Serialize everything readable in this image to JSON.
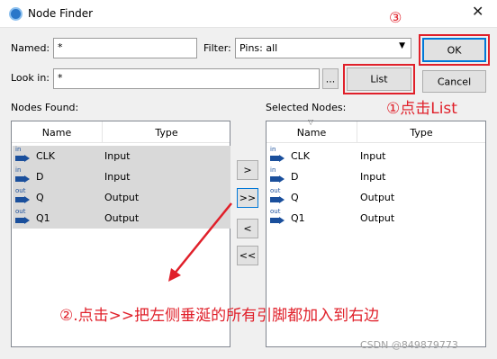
{
  "window": {
    "title": "Node Finder",
    "close_glyph": "✕"
  },
  "filter": {
    "named_label": "Named:",
    "named_value": "*",
    "filter_label": "Filter:",
    "filter_value": "Pins: all",
    "lookin_label": "Look in:",
    "lookin_value": "*",
    "browse_label": "...",
    "list_label": "List",
    "ok_label": "OK",
    "cancel_label": "Cancel"
  },
  "found": {
    "heading": "Nodes Found:",
    "col_name": "Name",
    "col_type": "Type",
    "rows": [
      {
        "dir": "in",
        "name": "CLK",
        "type": "Input"
      },
      {
        "dir": "in",
        "name": "D",
        "type": "Input"
      },
      {
        "dir": "out",
        "name": "Q",
        "type": "Output"
      },
      {
        "dir": "out",
        "name": "Q1",
        "type": "Output"
      }
    ]
  },
  "transfer": {
    "add_one": ">",
    "add_all": ">>",
    "remove_one": "<",
    "remove_all": "<<"
  },
  "selected": {
    "heading": "Selected Nodes:",
    "col_name": "Name",
    "col_type": "Type",
    "rows": [
      {
        "dir": "in",
        "name": "CLK",
        "type": "Input"
      },
      {
        "dir": "in",
        "name": "D",
        "type": "Input"
      },
      {
        "dir": "out",
        "name": "Q",
        "type": "Output"
      },
      {
        "dir": "out",
        "name": "Q1",
        "type": "Output"
      }
    ]
  },
  "annotations": {
    "step1": "①点击List",
    "step2": "②.点击>>把左侧垂涎的所有引脚都加入到右边",
    "step3": "③",
    "color": "#e0202a"
  },
  "watermark": "CSDN @849879773",
  "icons": {
    "app": "app-logo-icon",
    "pin_in": "input-pin-icon",
    "pin_out": "output-pin-icon"
  }
}
